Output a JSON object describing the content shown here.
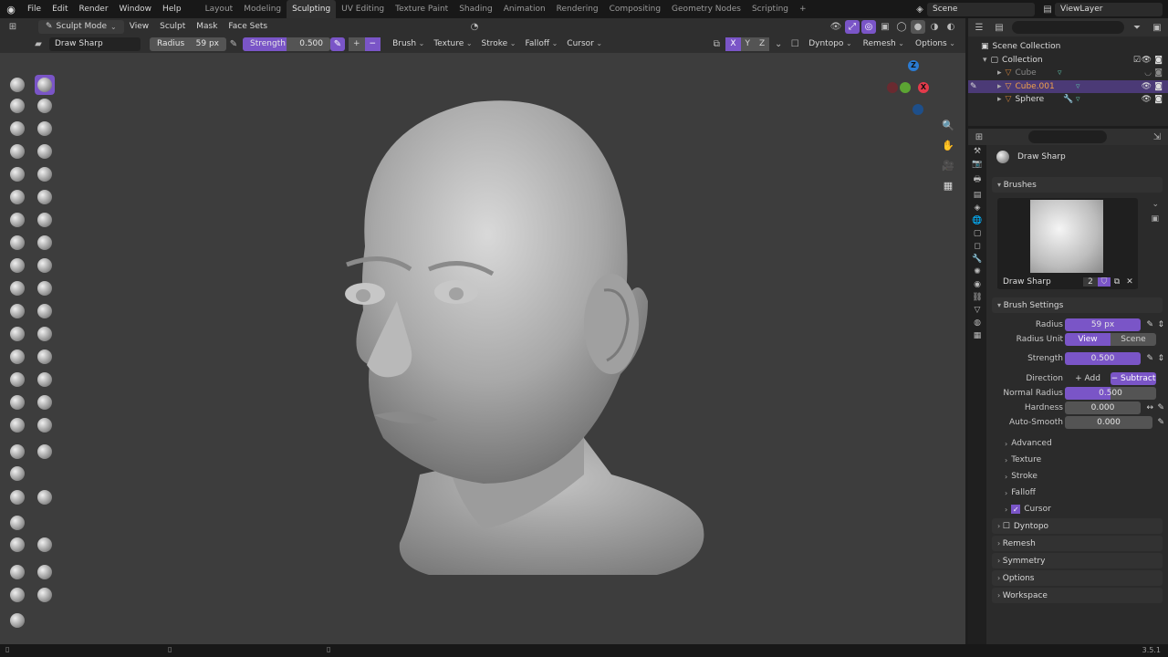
{
  "menu": {
    "items": [
      "File",
      "Edit",
      "Render",
      "Window",
      "Help"
    ],
    "workspaces": [
      "Layout",
      "Modeling",
      "Sculpting",
      "UV Editing",
      "Texture Paint",
      "Shading",
      "Animation",
      "Rendering",
      "Compositing",
      "Geometry Nodes",
      "Scripting"
    ],
    "active_workspace": "Sculpting",
    "add_tab": "+",
    "scene": "Scene",
    "view_layer": "ViewLayer"
  },
  "viewport_header": {
    "mode": "Sculpt Mode",
    "menus": [
      "View",
      "Sculpt",
      "Mask",
      "Face Sets"
    ]
  },
  "tool_header": {
    "brush_name": "Draw Sharp",
    "radius_label": "Radius",
    "radius_value": "59 px",
    "strength_label": "Strength",
    "strength_value": "0.500",
    "strength_fraction": 0.5,
    "plus": "+",
    "minus": "−",
    "menus": [
      "Brush",
      "Texture",
      "Stroke",
      "Falloff",
      "Cursor"
    ],
    "axes": [
      "X",
      "Y",
      "Z"
    ],
    "right_menus": [
      "Dyntopo",
      "Remesh",
      "Options"
    ]
  },
  "gizmo": {
    "x": "X",
    "y": "Y",
    "z": "Z"
  },
  "outliner": {
    "search_placeholder": "",
    "rows": [
      {
        "label": "Scene Collection"
      },
      {
        "label": "Collection"
      },
      {
        "label": "Cube"
      },
      {
        "label": "Cube.001"
      },
      {
        "label": "Sphere"
      }
    ]
  },
  "properties": {
    "brush_title": "Draw Sharp",
    "brushes_panel": "Brushes",
    "brush_datablock": "Draw Sharp",
    "brush_users": "2",
    "brush_settings_panel": "Brush Settings",
    "radius_label": "Radius",
    "radius_value": "59 px",
    "radius_unit_label": "Radius Unit",
    "radius_unit_options": [
      "View",
      "Scene"
    ],
    "strength_label": "Strength",
    "strength_value": "0.500",
    "direction_label": "Direction",
    "direction_options": [
      "Add",
      "Subtract"
    ],
    "normal_radius_label": "Normal Radius",
    "normal_radius_value": "0.500",
    "normal_radius_fraction": 0.5,
    "hardness_label": "Hardness",
    "hardness_value": "0.000",
    "autosmooth_label": "Auto-Smooth",
    "autosmooth_value": "0.000",
    "subpanels": [
      "Advanced",
      "Texture",
      "Stroke",
      "Falloff",
      "Cursor"
    ],
    "panels": [
      "Dyntopo",
      "Remesh",
      "Symmetry",
      "Options",
      "Workspace"
    ]
  },
  "status": {
    "version": "3.5.1"
  },
  "colors": {
    "accent": "#7a55c7",
    "viewport_bg": "#3d3d3d",
    "selected_row": "#4b3a76"
  }
}
